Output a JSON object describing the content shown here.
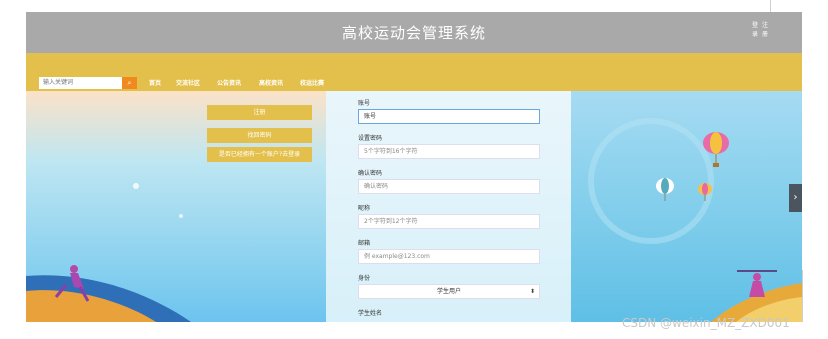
{
  "header": {
    "title": "高校运动会管理系统",
    "top_links": [
      "登",
      "注",
      "录",
      "册"
    ]
  },
  "search": {
    "placeholder": "输入关键词"
  },
  "nav": {
    "items": [
      "首页",
      "交流社区",
      "公告资讯",
      "高校资讯",
      "校运比赛"
    ]
  },
  "left_actions": {
    "register": "注册",
    "find_password": "找回密码",
    "have_account": "是否已经拥有一个账户?去登录"
  },
  "form": {
    "account_label": "账号",
    "account_value": "账号",
    "password_label": "设置密码",
    "password_placeholder": "5个字符到16个字符",
    "confirm_label": "确认密码",
    "confirm_placeholder": "确认密码",
    "nickname_label": "昵称",
    "nickname_placeholder": "2个字符到12个字符",
    "email_label": "邮箱",
    "email_placeholder": "例 example@123.com",
    "role_label": "身份",
    "role_value": "学生用户",
    "student_name_label": "学生姓名"
  },
  "watermark": "CSDN @weixin_MZ_ZXD001",
  "colors": {
    "titlebar": "#a9a9a9",
    "navbar": "#e3c04b",
    "accent": "#f08a1f"
  },
  "icons": {
    "search": "search-icon",
    "select": "chevron-down-icon",
    "side": "chevron-right-icon"
  }
}
